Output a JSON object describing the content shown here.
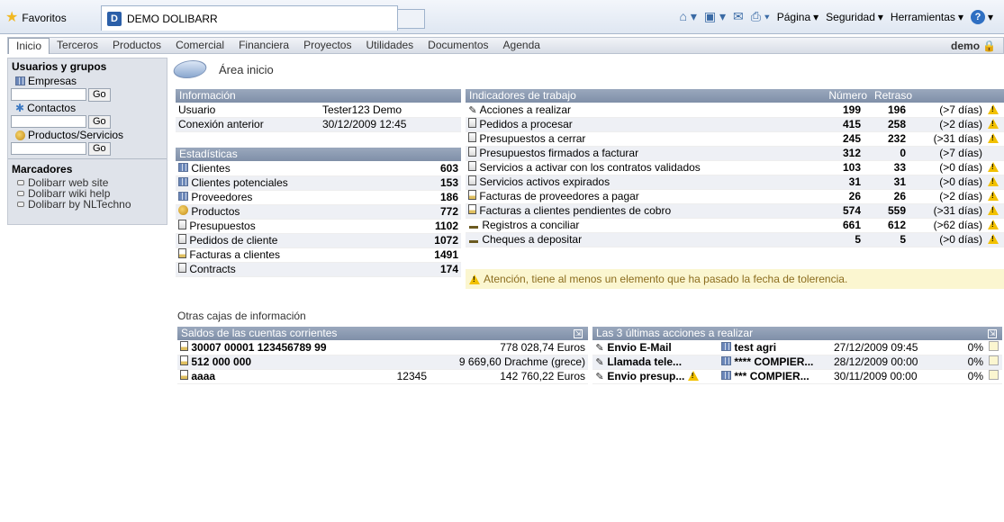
{
  "browser": {
    "favorites_label": "Favoritos",
    "tab_title": "DEMO DOLIBARR",
    "tools": [
      "Página",
      "Seguridad",
      "Herramientas"
    ]
  },
  "menu": {
    "items": [
      "Inicio",
      "Terceros",
      "Productos",
      "Comercial",
      "Financiera",
      "Proyectos",
      "Utilidades",
      "Documentos",
      "Agenda"
    ],
    "active": "Inicio",
    "user": "demo"
  },
  "left": {
    "heading": "Usuarios y grupos",
    "search": [
      {
        "label": "Empresas",
        "button": "Go",
        "value": ""
      },
      {
        "label": "Contactos",
        "button": "Go",
        "value": ""
      },
      {
        "label": "Productos/Servicios",
        "button": "Go",
        "value": ""
      }
    ],
    "bookmarks_heading": "Marcadores",
    "bookmarks": [
      "Dolibarr web site",
      "Dolibarr wiki help",
      "Dolibarr by NLTechno"
    ]
  },
  "page_title": "Área inicio",
  "info": {
    "title": "Información",
    "rows": [
      {
        "label": "Usuario",
        "value": "Tester123 Demo"
      },
      {
        "label": "Conexión anterior",
        "value": "30/12/2009 12:45"
      }
    ]
  },
  "stats": {
    "title": "Estadísticas",
    "rows": [
      {
        "label": "Clientes",
        "value": "603"
      },
      {
        "label": "Clientes potenciales",
        "value": "153"
      },
      {
        "label": "Proveedores",
        "value": "186"
      },
      {
        "label": "Productos",
        "value": "772"
      },
      {
        "label": "Presupuestos",
        "value": "1102"
      },
      {
        "label": "Pedidos de cliente",
        "value": "1072"
      },
      {
        "label": "Facturas a clientes",
        "value": "1491"
      },
      {
        "label": "Contracts",
        "value": "174"
      }
    ]
  },
  "indicators": {
    "title": "Indicadores de trabajo",
    "col_number": "Número",
    "col_delay": "Retraso",
    "rows": [
      {
        "label": "Acciones a realizar",
        "number": "199",
        "delay": "196",
        "tolerance": "(>7 días)",
        "warn": true
      },
      {
        "label": "Pedidos a procesar",
        "number": "415",
        "delay": "258",
        "tolerance": "(>2 días)",
        "warn": true
      },
      {
        "label": "Presupuestos a cerrar",
        "number": "245",
        "delay": "232",
        "tolerance": "(>31 días)",
        "warn": true
      },
      {
        "label": "Presupuestos firmados a facturar",
        "number": "312",
        "delay": "0",
        "tolerance": "(>7 días)",
        "warn": false
      },
      {
        "label": "Servicios a activar con los contratos validados",
        "number": "103",
        "delay": "33",
        "tolerance": "(>0 días)",
        "warn": true
      },
      {
        "label": "Servicios activos expirados",
        "number": "31",
        "delay": "31",
        "tolerance": "(>0 días)",
        "warn": true
      },
      {
        "label": "Facturas de proveedores a pagar",
        "number": "26",
        "delay": "26",
        "tolerance": "(>2 días)",
        "warn": true
      },
      {
        "label": "Facturas a clientes pendientes de cobro",
        "number": "574",
        "delay": "559",
        "tolerance": "(>31 días)",
        "warn": true
      },
      {
        "label": "Registros a conciliar",
        "number": "661",
        "delay": "612",
        "tolerance": "(>62 días)",
        "warn": true
      },
      {
        "label": "Cheques a depositar",
        "number": "5",
        "delay": "5",
        "tolerance": "(>0 días)",
        "warn": true
      }
    ],
    "alert": "Atención, tiene al menos un elemento que ha pasado la fecha de tolerencia."
  },
  "otras": "Otras cajas de información",
  "accounts": {
    "title": "Saldos de las cuentas corrientes",
    "rows": [
      {
        "name": "30007 00001 123456789 99",
        "code": "",
        "balance": "778 028,74 Euros"
      },
      {
        "name": "512 000 000",
        "code": "",
        "balance": "9 669,60 Drachme (grece)"
      },
      {
        "name": "aaaa",
        "code": "12345",
        "balance": "142 760,22 Euros"
      }
    ]
  },
  "actions": {
    "title": "Las 3 últimas acciones a realizar",
    "rows": [
      {
        "label": "Envio E-Mail",
        "company": "test agri",
        "date": "27/12/2009 09:45",
        "pct": "0%",
        "warn": false
      },
      {
        "label": "Llamada tele...",
        "company": "**** COMPIER...",
        "date": "28/12/2009 00:00",
        "pct": "0%",
        "warn": false
      },
      {
        "label": "Envio presup...",
        "company": "*** COMPIER...",
        "date": "30/11/2009 00:00",
        "pct": "0%",
        "warn": true
      }
    ]
  }
}
